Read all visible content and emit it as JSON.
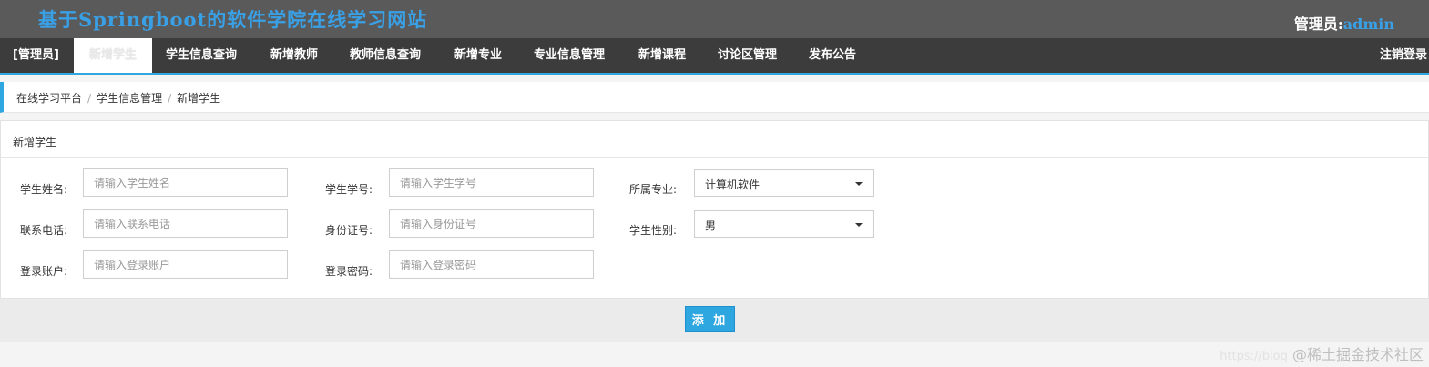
{
  "header": {
    "site_title": "基于Springboot的软件学院在线学习网站",
    "admin_label": "管理员:",
    "admin_name": "admin"
  },
  "nav": {
    "role": "[管理员]",
    "items": [
      {
        "label": "新增学生",
        "active": true
      },
      {
        "label": "学生信息查询"
      },
      {
        "label": "新增教师"
      },
      {
        "label": "教师信息查询"
      },
      {
        "label": "新增专业"
      },
      {
        "label": "专业信息管理"
      },
      {
        "label": "新增课程"
      },
      {
        "label": "讨论区管理"
      },
      {
        "label": "发布公告"
      }
    ],
    "logout": "注销登录"
  },
  "breadcrumb": {
    "items": [
      "在线学习平台",
      "学生信息管理",
      "新增学生"
    ],
    "separator": "/"
  },
  "panel": {
    "title": "新增学生"
  },
  "form": {
    "student_name": {
      "label": "学生姓名:",
      "placeholder": "请输入学生姓名",
      "value": ""
    },
    "student_no": {
      "label": "学生学号:",
      "placeholder": "请输入学生学号",
      "value": ""
    },
    "major": {
      "label": "所属专业:",
      "value": "计算机软件"
    },
    "phone": {
      "label": "联系电话:",
      "placeholder": "请输入联系电话",
      "value": ""
    },
    "id_card": {
      "label": "身份证号:",
      "placeholder": "请输入身份证号",
      "value": ""
    },
    "gender": {
      "label": "学生性别:",
      "value": "男"
    },
    "account": {
      "label": "登录账户:",
      "placeholder": "请输入登录账户",
      "value": ""
    },
    "password": {
      "label": "登录密码:",
      "placeholder": "请输入登录密码",
      "value": ""
    }
  },
  "actions": {
    "add_label": "添 加"
  },
  "watermark": {
    "url": "https://blog",
    "text": "@稀土掘金技术社区"
  },
  "colors": {
    "accent": "#2ea7e0",
    "title_blue": "#3aa0e6",
    "topbar_bg": "#5a5a5a",
    "navbar_bg": "#3c3c3c"
  }
}
